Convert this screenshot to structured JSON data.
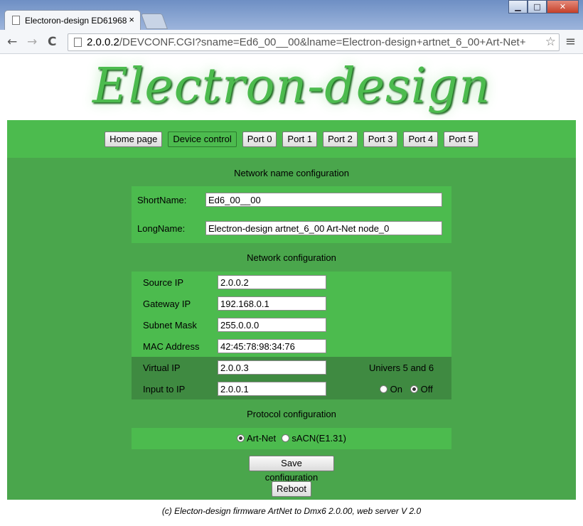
{
  "browser": {
    "tab_title": "Electoron-design ED61968",
    "tab_close": "×",
    "url_host": "2.0.0.2",
    "url_path": "/DEVCONF.CGI?sname=Ed6_00__00&lname=Electron-design+artnet_6_00+Art-Net+",
    "star": "☆",
    "back": "←",
    "forward": "→",
    "reload": "C",
    "menu": "≡",
    "win_min": "▁",
    "win_max": "□",
    "win_close": "✕"
  },
  "logo": "Electron-design",
  "nav": [
    "Home page",
    "Device control",
    "Port 0",
    "Port 1",
    "Port 2",
    "Port 3",
    "Port 4",
    "Port 5"
  ],
  "network_name": {
    "title": "Network name configuration",
    "short_label": "ShortName:",
    "short_value": "Ed6_00__00",
    "long_label": "LongName:",
    "long_value": "Electron-design artnet_6_00 Art-Net node_0"
  },
  "network": {
    "title": "Network configuration",
    "source_label": "Source IP",
    "source_value": "2.0.0.2",
    "gateway_label": "Gateway IP",
    "gateway_value": "192.168.0.1",
    "mask_label": "Subnet Mask",
    "mask_value": "255.0.0.0",
    "mac_label": "MAC Address",
    "mac_value": "42:45:78:98:34:76",
    "virtual_label": "Virtual IP",
    "virtual_value": "2.0.0.3",
    "input_label": "Input to IP",
    "input_value": "2.0.0.1",
    "univers_label": "Univers 5 and 6",
    "on_label": "On",
    "off_label": "Off",
    "univers_selected": "Off"
  },
  "protocol": {
    "title": "Protocol configuration",
    "artnet_label": "Art-Net",
    "sacn_label": "sACN(E1.31)",
    "selected": "Art-Net"
  },
  "buttons": {
    "save": "Save configuration",
    "reboot": "Reboot"
  },
  "footer": "(c) Electon-design firmware ArtNet to Dmx6 2.0.00, web server V 2.0"
}
